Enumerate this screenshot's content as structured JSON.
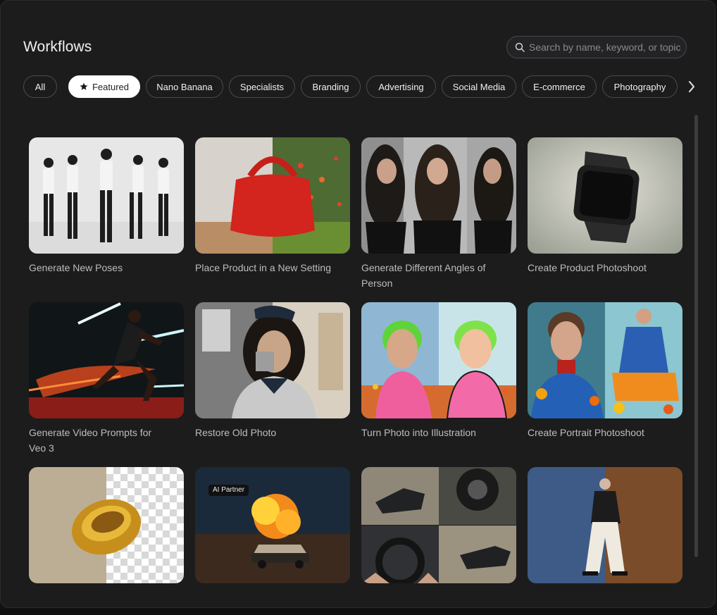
{
  "header": {
    "title": "Workflows"
  },
  "search": {
    "placeholder": "Search by name, keyword, or topic"
  },
  "filters": [
    {
      "label": "All",
      "active": false
    },
    {
      "label": "Featured",
      "active": true,
      "icon": "star-icon"
    },
    {
      "label": "Nano Banana",
      "active": false
    },
    {
      "label": "Specialists",
      "active": false
    },
    {
      "label": "Branding",
      "active": false
    },
    {
      "label": "Advertising",
      "active": false
    },
    {
      "label": "Social Media",
      "active": false
    },
    {
      "label": "E-commerce",
      "active": false
    },
    {
      "label": "Photography",
      "active": false
    }
  ],
  "cards": [
    {
      "title": "Generate New Poses"
    },
    {
      "title": "Place Product in a New Setting"
    },
    {
      "title": "Generate Different Angles of Person"
    },
    {
      "title": "Create Product Photoshoot"
    },
    {
      "title": "Generate Video Prompts for Veo 3"
    },
    {
      "title": "Restore Old Photo"
    },
    {
      "title": "Turn Photo into Illustration"
    },
    {
      "title": "Create Portrait Photoshoot"
    },
    {
      "title": ""
    },
    {
      "title": "",
      "badge": "AI Partner"
    },
    {
      "title": ""
    },
    {
      "title": ""
    }
  ]
}
